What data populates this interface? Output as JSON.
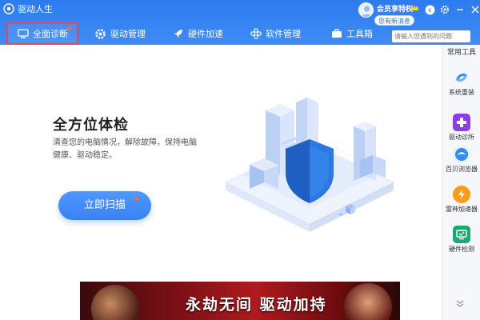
{
  "app": {
    "title": "驱动人生"
  },
  "user": {
    "member_label": "会员享特权",
    "notice": "您有新消息"
  },
  "tabs": [
    {
      "label": "全面诊断",
      "active": true
    },
    {
      "label": "驱动管理"
    },
    {
      "label": "硬件加速"
    },
    {
      "label": "软件管理"
    },
    {
      "label": "工具箱"
    }
  ],
  "search": {
    "placeholder": "请输入您遇到的问题"
  },
  "main": {
    "title": "全方位体检",
    "description": "清查您的电脑情况，解除故障，保持电脑健康、驱动稳定。",
    "scan_button": "立即扫描"
  },
  "tools": {
    "title": "常用工具",
    "items": [
      {
        "label": "系统重装",
        "icon": "system-reinstall-icon"
      },
      {
        "label": "驱动诊所",
        "icon": "driver-clinic-icon"
      },
      {
        "label": "百贝浏览器",
        "icon": "browser-icon"
      },
      {
        "label": "雷神加速器",
        "icon": "thunder-accelerator-icon"
      },
      {
        "label": "硬件检测",
        "icon": "hardware-check-icon"
      }
    ]
  },
  "banner": {
    "text": "永劫无间 驱动加持"
  },
  "colors": {
    "header": "#2d7bf0",
    "accent": "#3a82f3",
    "active_tab_border": "#e14b4b"
  }
}
